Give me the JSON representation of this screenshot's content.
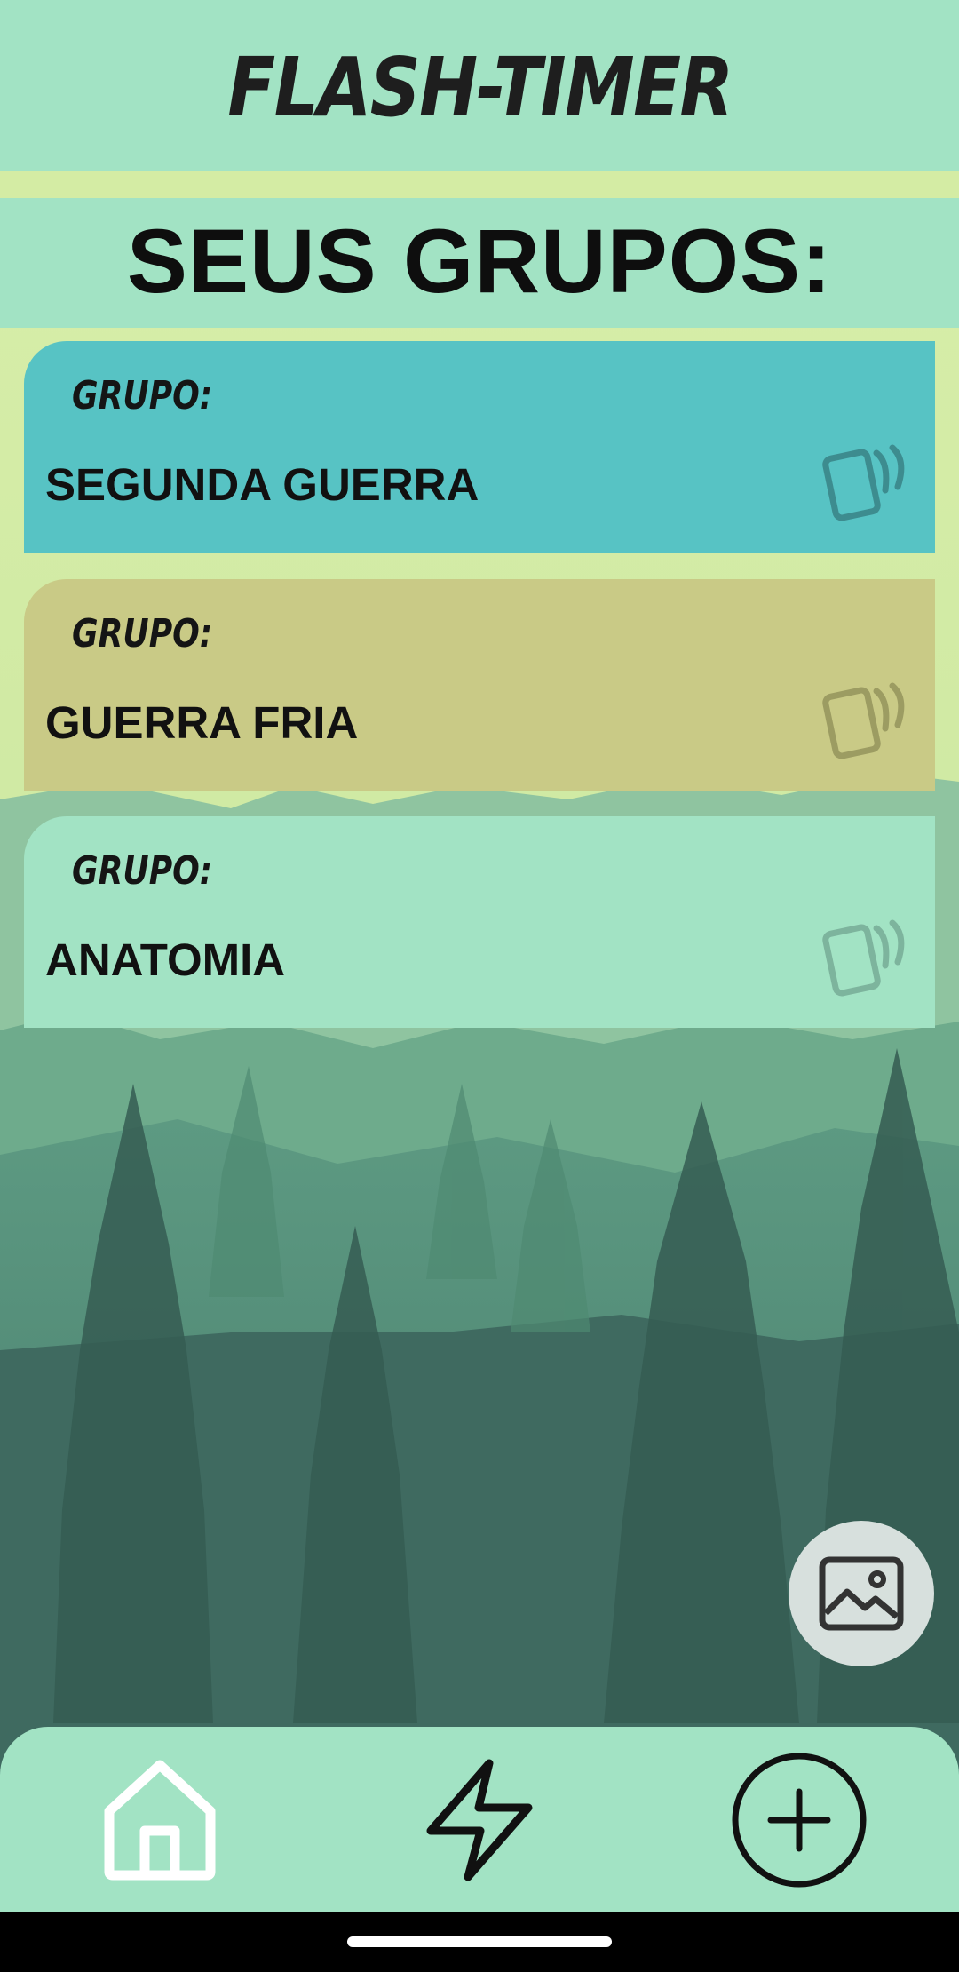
{
  "app": {
    "title": "FLASH-TIMER"
  },
  "section": {
    "title": "SEUS GRUPOS:"
  },
  "groups": [
    {
      "label": "GRUPO:",
      "name": "SEGUNDA GUERRA",
      "color": "#57c3c4"
    },
    {
      "label": "GRUPO:",
      "name": "GUERRA FRIA",
      "color": "#c9ca86"
    },
    {
      "label": "GRUPO:",
      "name": "ANATOMIA",
      "color": "#a2e3c4"
    }
  ],
  "icons": {
    "group_card": "flashcards-icon",
    "fab": "image-icon",
    "nav": [
      "home-icon",
      "lightning-bolt-icon",
      "add-circle-icon"
    ]
  },
  "colors": {
    "header": "#a2e3c4",
    "nav_bar": "#a2e3c4",
    "fab": "#d7e0dd"
  }
}
